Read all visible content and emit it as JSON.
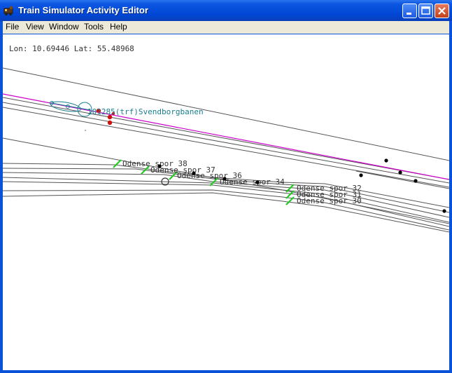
{
  "window": {
    "title": "Train Simulator Activity Editor",
    "buttons": {
      "minimize": "minimize-icon",
      "maximize": "maximize-icon",
      "close": "close-icon"
    }
  },
  "menu": {
    "items": [
      {
        "label": "File"
      },
      {
        "label": "View"
      },
      {
        "label": "Window"
      },
      {
        "label": "Tools"
      },
      {
        "label": "Help"
      }
    ]
  },
  "status": {
    "coords": "Lon: 10.69446 Lat: 55.48968"
  },
  "map": {
    "route_label": "101285(trf)Svendborgbanen",
    "sidings": [
      "Odense spor 38",
      "Odense spor 37",
      "Odense spor 36",
      "Odense spor 34",
      "Odense spor 32",
      "Odense spor 31",
      "Odense spor 30"
    ],
    "colors": {
      "track": "#555555",
      "route_line": "#cc00cc",
      "label_teal": "#1a7f8f",
      "label_gray": "#333333",
      "siding_marker": "#22cc22",
      "signal": "#cc1111",
      "junction_node": "#000000"
    }
  }
}
